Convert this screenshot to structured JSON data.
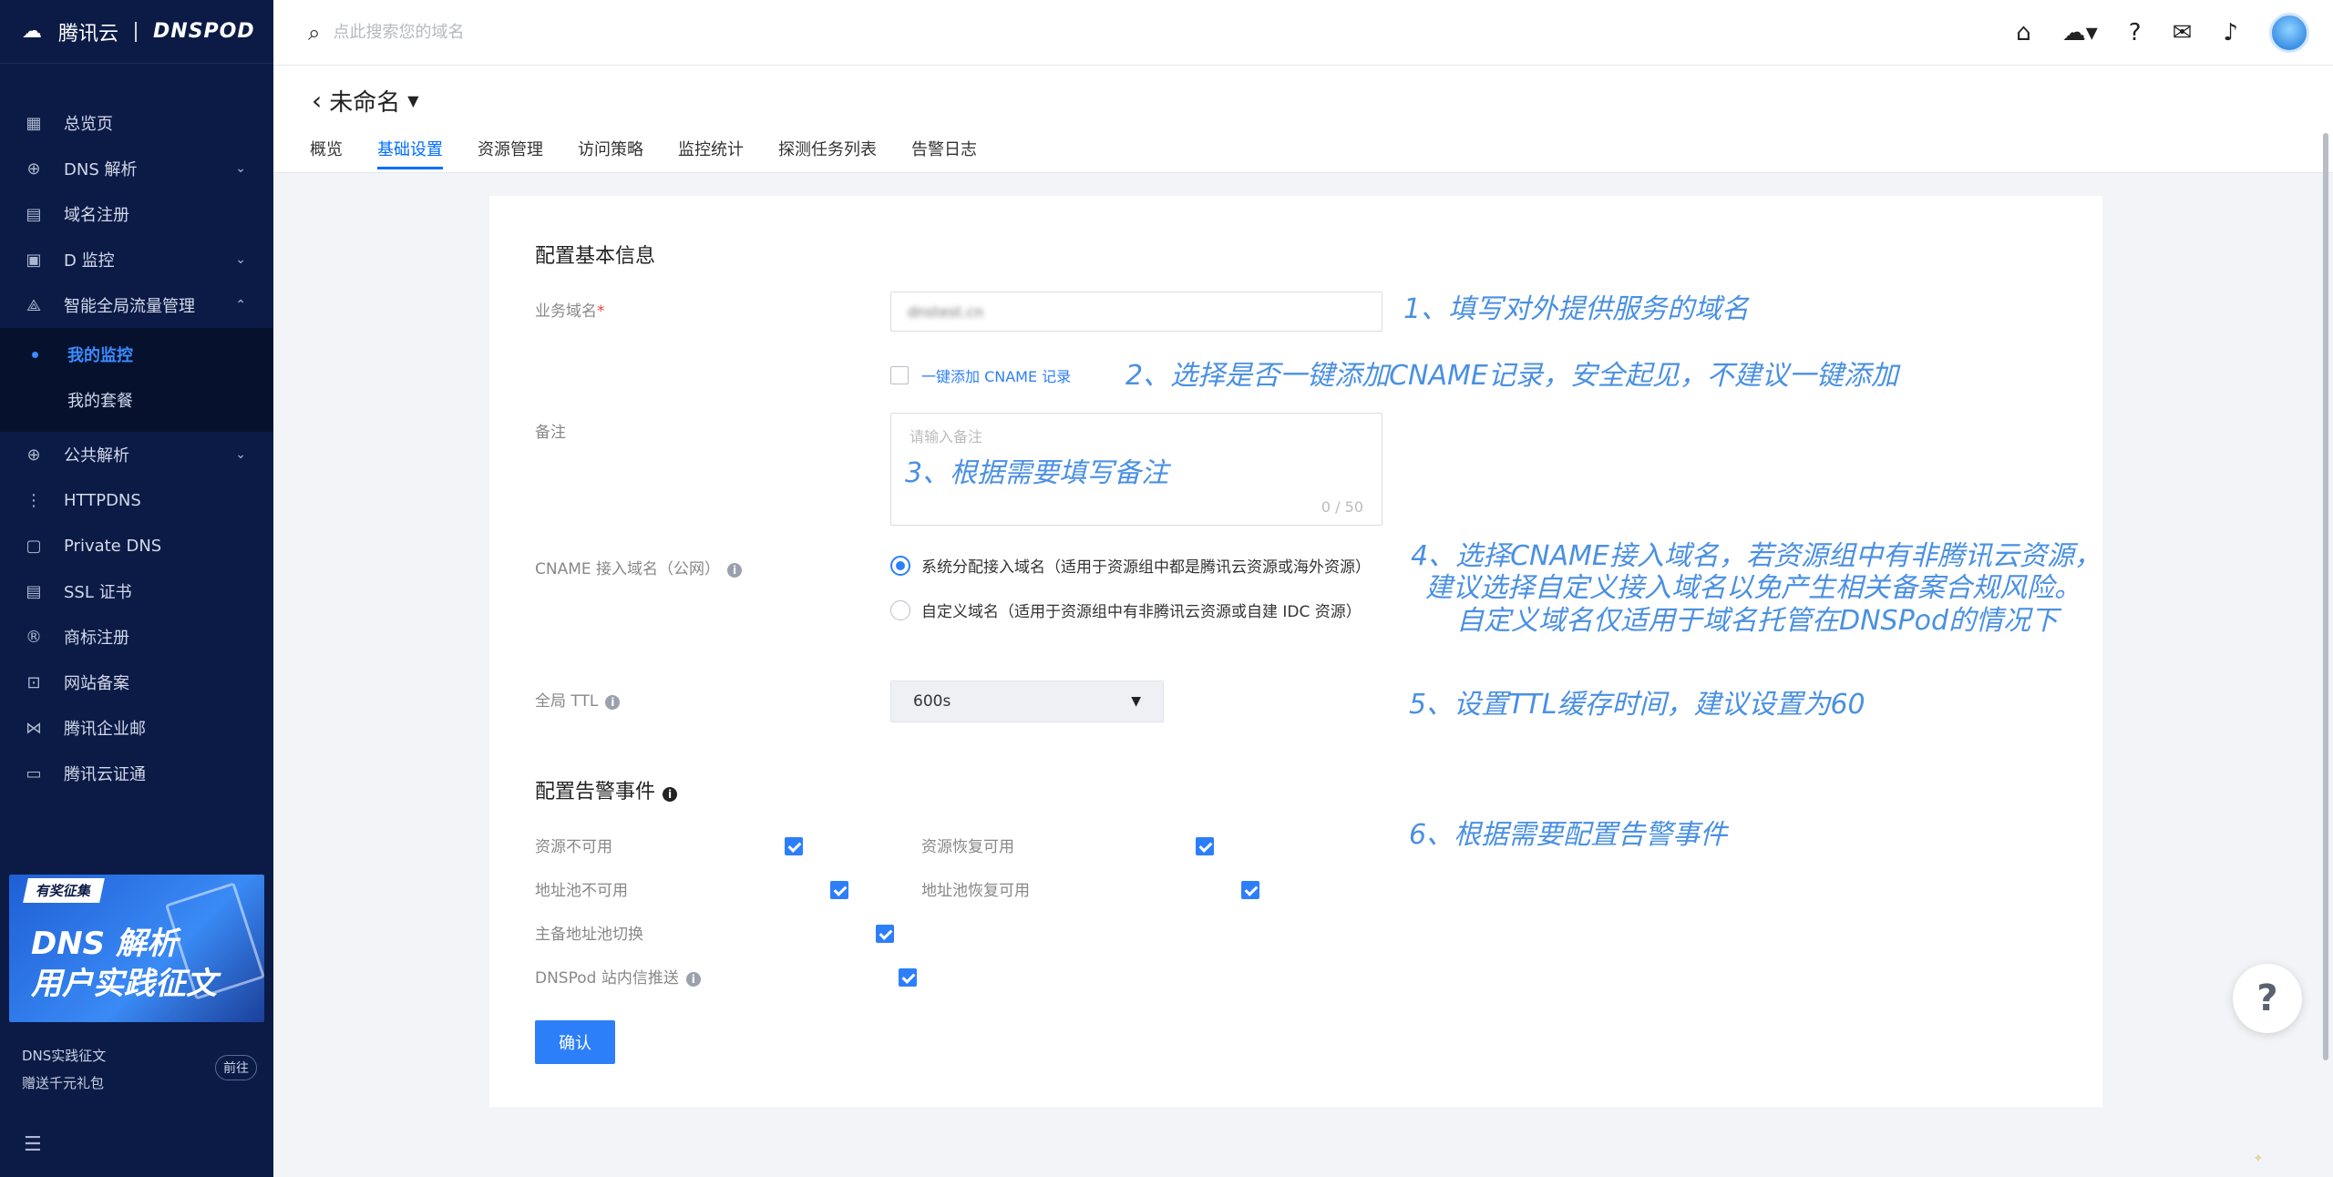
{
  "sidebar": {
    "logo_cn": "腾讯云",
    "logo_en": "DNSPOD",
    "items": [
      {
        "label": "总览页",
        "icon": "grid-icon",
        "chevron": ""
      },
      {
        "label": "DNS 解析",
        "icon": "globe-icon",
        "chevron": "v"
      },
      {
        "label": "域名注册",
        "icon": "calendar-icon",
        "chevron": ""
      },
      {
        "label": "D 监控",
        "icon": "monitor-icon",
        "chevron": "v"
      },
      {
        "label": "智能全局流量管理",
        "icon": "network-icon",
        "chevron": "^"
      }
    ],
    "sub_items": [
      {
        "label": "我的监控",
        "active": true
      },
      {
        "label": "我的套餐",
        "active": false
      }
    ],
    "items_after": [
      {
        "label": "公共解析",
        "icon": "globe-icon",
        "chevron": "v"
      },
      {
        "label": "HTTPDNS",
        "icon": "share-icon",
        "chevron": ""
      },
      {
        "label": "Private DNS",
        "icon": "lock-box-icon",
        "chevron": ""
      },
      {
        "label": "SSL 证书",
        "icon": "certificate-icon",
        "chevron": ""
      },
      {
        "label": "商标注册",
        "icon": "registered-icon",
        "chevron": ""
      },
      {
        "label": "网站备案",
        "icon": "filing-icon",
        "chevron": ""
      },
      {
        "label": "腾讯企业邮",
        "icon": "mail-icon",
        "chevron": ""
      },
      {
        "label": "腾讯云证通",
        "icon": "id-card-icon",
        "chevron": ""
      }
    ],
    "promo": {
      "tag": "有奖征集",
      "line1": "DNS 解析",
      "line2": "用户实践征文",
      "caption1": "DNS实践征文",
      "caption2": "赠送千元礼包",
      "go": "前往"
    }
  },
  "topbar": {
    "search_placeholder": "点此搜索您的域名"
  },
  "header": {
    "title": "未命名",
    "tabs": [
      {
        "label": "概览",
        "active": false
      },
      {
        "label": "基础设置",
        "active": true
      },
      {
        "label": "资源管理",
        "active": false
      },
      {
        "label": "访问策略",
        "active": false
      },
      {
        "label": "监控统计",
        "active": false
      },
      {
        "label": "探测任务列表",
        "active": false
      },
      {
        "label": "告警日志",
        "active": false
      }
    ]
  },
  "form": {
    "section1_title": "配置基本信息",
    "domain_label": "业务域名",
    "domain_required": "*",
    "domain_value": "dnstest.cn",
    "cname_checkbox_label": "一键添加 CNAME 记录",
    "remark_label": "备注",
    "remark_placeholder": "请输入备注",
    "remark_count": "0 / 50",
    "cname_domain_label": "CNAME 接入域名（公网）",
    "radio1": "系统分配接入域名（适用于资源组中都是腾讯云资源或海外资源）",
    "radio2": "自定义域名（适用于资源组中有非腾讯云资源或自建 IDC 资源）",
    "ttl_label": "全局 TTL",
    "ttl_value": "600s",
    "section2_title": "配置告警事件",
    "alarms_left": [
      "资源不可用",
      "地址池不可用",
      "主备地址池切换",
      "DNSPod 站内信推送"
    ],
    "alarms_right": [
      "资源恢复可用",
      "地址池恢复可用"
    ],
    "confirm": "确认"
  },
  "annotations": {
    "a1": "1、填写对外提供服务的域名",
    "a2": "2、选择是否一键添加CNAME记录，安全起见，不建议一键添加",
    "a3": "3、根据需要填写备注",
    "a4_1": "4、选择CNAME接入域名，若资源组中有非腾讯云资源，",
    "a4_2": "建议选择自定义接入域名以免产生相关备案合规风险。",
    "a4_3": "自定义域名仅适用于域名托管在DNSPod的情况下",
    "a5": "5、设置TTL缓存时间，建议设置为60",
    "a6": "6、根据需要配置告警事件"
  },
  "help_fab": "?",
  "colors": {
    "sidebar_bg": "#0b1b46",
    "accent": "#2d7ff9",
    "annotation": "#4a90e2"
  }
}
